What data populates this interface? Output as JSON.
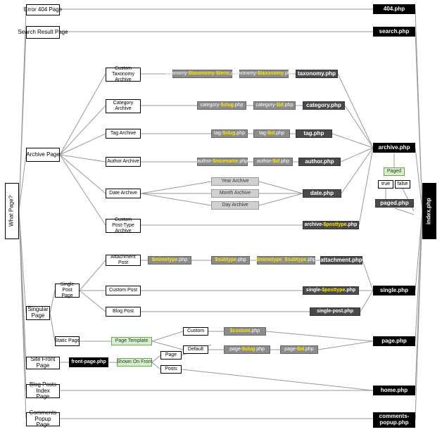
{
  "root_label": "What Page?",
  "index_label": "index.php",
  "error404": {
    "label": "Error 404 Page",
    "tpl": "404.php"
  },
  "search": {
    "label": "Search Result Page",
    "tpl": "search.php"
  },
  "archive": {
    "label": "Archive Page",
    "tpl": "archive.php",
    "paged_label": "Paged",
    "paged_true": "true",
    "paged_false": "false",
    "paged_tpl": "paged.php",
    "tax": {
      "label": "Custom Taxonomy Archive",
      "n1_pre": "taxonomy-",
      "n1_var": "$taxonomy-$term",
      "n1_suf": ".php",
      "n2_pre": "taxonomy-",
      "n2_var": "$taxonomy",
      "n2_suf": ".php",
      "tpl": "taxonomy.php"
    },
    "cat": {
      "label": "Category Archive",
      "n1_pre": "category-",
      "n1_var": "$slug",
      "n1_suf": ".php",
      "n2_pre": "category-",
      "n2_var": "$id",
      "n2_suf": ".php",
      "tpl": "category.php"
    },
    "tag": {
      "label": "Tag Archive",
      "n1_pre": "tag-",
      "n1_var": "$slug",
      "n1_suf": ".php",
      "n2_pre": "tag-",
      "n2_var": "$id",
      "n2_suf": ".php",
      "tpl": "tag.php"
    },
    "author": {
      "label": "Author Archive",
      "n1_pre": "author-",
      "n1_var": "$nicename",
      "n1_suf": ".php",
      "n2_pre": "author-",
      "n2_var": "$id",
      "n2_suf": ".php",
      "tpl": "author.php"
    },
    "date": {
      "label": "Date Archive",
      "year": "Year Archive",
      "month": "Month Archive",
      "day": "Day Archive",
      "tpl": "date.php"
    },
    "cpt": {
      "label": "Custom Post-Type Archive",
      "n1_pre": "archive-",
      "n1_var": "$posttype",
      "n1_suf": ".php"
    }
  },
  "singular": {
    "label": "Singular Page",
    "single": {
      "label": "Single Post Page",
      "tpl": "single.php",
      "attachment": {
        "label": "Attachment Post",
        "n1_var": "$mimetype",
        "n1_suf": ".php",
        "n2_var": "$subtype",
        "n2_suf": ".php",
        "n3_var": "$mimetype_$subtype",
        "n3_suf": ".php",
        "tpl": "attachment.php"
      },
      "custom": {
        "label": "Custom Post",
        "n1_pre": "single-",
        "n1_var": "$posttype",
        "n1_suf": ".php"
      },
      "blog": {
        "label": "Blog Post",
        "tpl": "single-post.php"
      }
    },
    "static": {
      "label": "Static Page",
      "pt_label": "Page Template",
      "custom_label": "Custom",
      "default_label": "Default",
      "custom_var": "$custom",
      "custom_suf": ".php",
      "n1_pre": "page-",
      "n1_var": "$slug",
      "n1_suf": ".php",
      "n2_pre": "page-",
      "n2_var": "$id",
      "n2_suf": ".php",
      "tpl": "page.php"
    }
  },
  "front": {
    "label": "Site Front Page",
    "tpl": "front-page.php",
    "decide": "Shown On Front",
    "page": "Page",
    "posts": "Posts"
  },
  "home": {
    "label": "Blog Posts Index Page",
    "tpl": "home.php"
  },
  "comments": {
    "label": "Comments Popup Page",
    "tpl": "comments-popup.php"
  }
}
